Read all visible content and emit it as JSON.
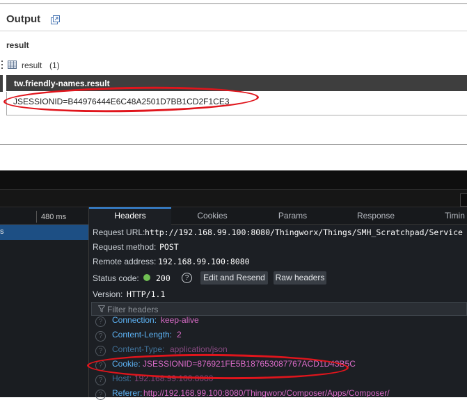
{
  "output_panel": {
    "title": "Output",
    "section_label": "result",
    "tree_node_label": "result",
    "tree_node_count": "(1)",
    "grid_header": "tw.friendly-names.result",
    "grid_value": "JSESSIONID=B44976444E6C48A2501D7BB1CD2F1CE3"
  },
  "devtools": {
    "waterfall_tick": "480 ms",
    "selected_row_fragment": "s",
    "tabs": [
      "Headers",
      "Cookies",
      "Params",
      "Response",
      "Timin"
    ],
    "active_tab": "Headers",
    "request": {
      "url_label": "Request URL:",
      "url_value": "http://192.168.99.100:8080/Thingworx/Things/SMH_Scratchpad/Service",
      "method_label": "Request method:",
      "method_value": "POST",
      "remote_label": "Remote address:",
      "remote_value": "192.168.99.100:8080",
      "status_label": "Status code:",
      "status_value": "200",
      "status_color": "#70bf53",
      "edit_resend_label": "Edit and Resend",
      "raw_headers_label": "Raw headers",
      "version_label": "Version:",
      "version_value": "HTTP/1.1"
    },
    "filter_placeholder": "Filter headers",
    "headers": [
      {
        "name": "Connection:",
        "value": "keep-alive"
      },
      {
        "name": "Content-Length:",
        "value": "2"
      },
      {
        "name": "Content-Type:",
        "value": "application/json"
      },
      {
        "name": "Cookie:",
        "value": "JSESSIONID=876921FE5B187653087767ACD1D43B5C"
      },
      {
        "name": "Host:",
        "value": "192.168.99.100:8080"
      },
      {
        "name": "Referer:",
        "value": "http://192.168.99.100:8080/Thingworx/Composer/Apps/Composer/"
      }
    ]
  },
  "colors": {
    "highlight_oval": "#e0151c",
    "header_name": "#5db3f5",
    "header_value": "#d96bc7",
    "active_tab_accent": "#3a8ee6"
  }
}
